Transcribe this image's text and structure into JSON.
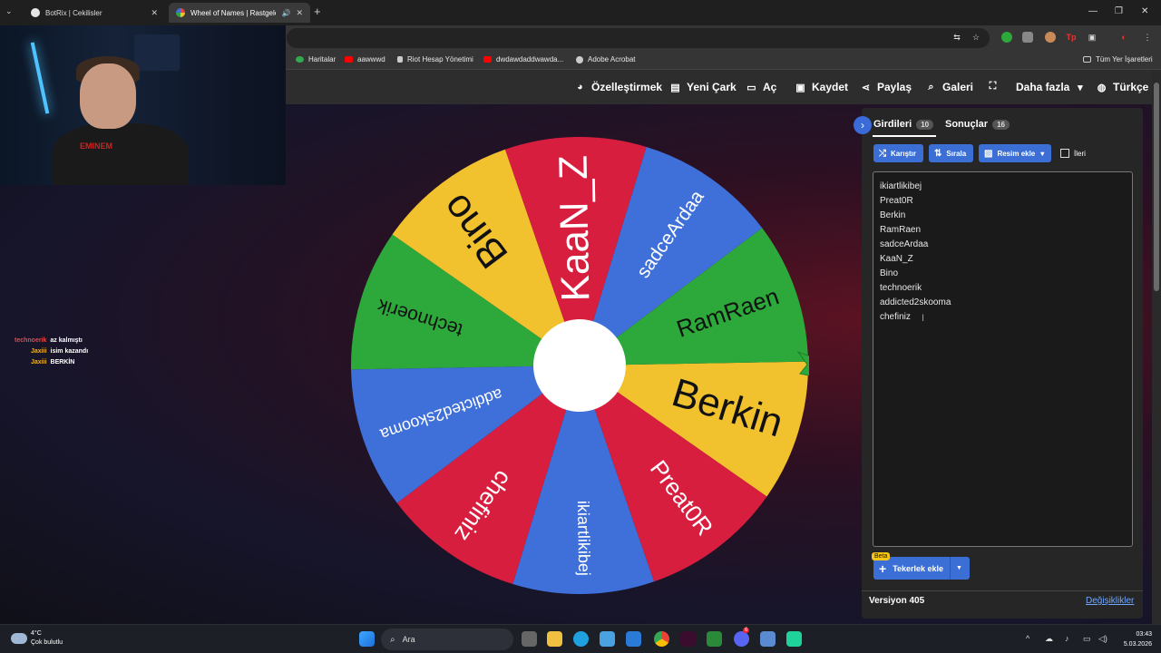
{
  "browser": {
    "tabs": [
      {
        "title": "BotRix | Cekilisler",
        "favicon_color": "#e6e6e6"
      },
      {
        "title": "Wheel of Names | Rastgele",
        "favicon_color": "#e8443a"
      }
    ],
    "bookmarks": [
      {
        "label": "Haritalar",
        "color": "#34a853"
      },
      {
        "label": "aawwwd",
        "color": "#ff0000"
      },
      {
        "label": "Riot Hesap Yönetimi",
        "color": "#cccccc"
      },
      {
        "label": "dwdawdaddwawda...",
        "color": "#ff0000"
      },
      {
        "label": "Adobe Acrobat",
        "color": "#cccccc"
      },
      {
        "label": "Tüm Yer İşaretleri",
        "color": "#cccccc"
      }
    ]
  },
  "nav": {
    "customize": "Özelleştirmek",
    "new_wheel": "Yeni Çark",
    "open": "Aç",
    "save": "Kaydet",
    "share": "Paylaş",
    "gallery": "Galeri",
    "more": "Daha fazla",
    "language": "Türkçe"
  },
  "wheel": {
    "colors": {
      "green": "#2ca93a",
      "yellow": "#f2c12e",
      "red": "#d81e3f",
      "blue": "#3f6fd9"
    },
    "segments": [
      {
        "label": "Berkin",
        "color": "#f2c12e"
      },
      {
        "label": "Preat0R",
        "color": "#d81e3f"
      },
      {
        "label": "ikiartlikibej",
        "color": "#3f6fd9"
      },
      {
        "label": "chefiniz",
        "color": "#d81e3f"
      },
      {
        "label": "addicted2skooma",
        "color": "#3f6fd9"
      },
      {
        "label": "technoerik",
        "color": "#2ca93a"
      },
      {
        "label": "Bino",
        "color": "#f2c12e"
      },
      {
        "label": "KaaN_Z",
        "color": "#d81e3f"
      },
      {
        "label": "sadceArdaa",
        "color": "#3f6fd9"
      },
      {
        "label": "RamRaen",
        "color": "#2ca93a"
      }
    ]
  },
  "panel": {
    "tab_entries": "Girdileri",
    "entries_count": "10",
    "tab_results": "Sonuçlar",
    "results_count": "16",
    "shuffle": "Karıştır",
    "sort": "Sırala",
    "add_image": "Resim ekle",
    "advanced": "İleri",
    "entries": [
      "ikiartlikibej",
      "Preat0R",
      "Berkin",
      "RamRaen",
      "sadceArdaa",
      "KaaN_Z",
      "Bino",
      "technoerik",
      "addicted2skooma",
      "chefiniz"
    ],
    "beta": "Beta",
    "add_wheel": "Tekerlek ekle",
    "version": "Versiyon 405",
    "changes": "Değişiklikler"
  },
  "webcam": {
    "shirt_text": "EMINEM"
  },
  "chat": [
    {
      "user": "technoerik",
      "message": "az kalmıştı",
      "color": "#e04a4a"
    },
    {
      "user": "Jaxiii",
      "message": "isim kazandı",
      "color": "#f0b429"
    },
    {
      "user": "Jaxiii",
      "message": "BERKİN",
      "color": "#f0b429"
    }
  ],
  "taskbar": {
    "temperature": "4°C",
    "weather": "Çok bulutlu",
    "search": "Ara",
    "time": "03:43",
    "date": "5.03.2026",
    "discord_badge": "6"
  }
}
